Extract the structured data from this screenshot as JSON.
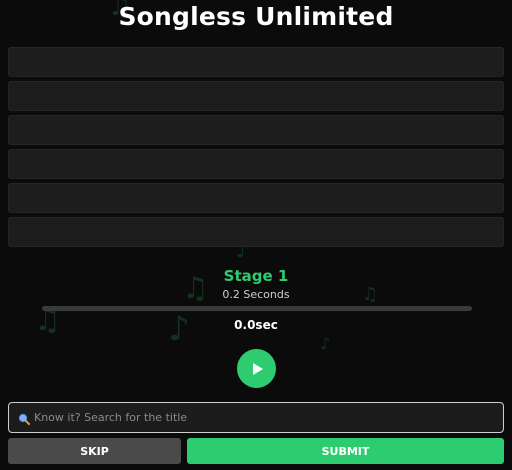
{
  "app": {
    "title": "Songless Unlimited"
  },
  "guess_slots": [
    "",
    "",
    "",
    "",
    "",
    ""
  ],
  "stage": {
    "title": "Stage 1",
    "subtitle": "0.2 Seconds",
    "progress_fraction": 0
  },
  "timer": {
    "text": "0.0sec"
  },
  "player": {
    "play_icon": "play-icon"
  },
  "search": {
    "placeholder": "Know it? Search for the title",
    "value": "",
    "icon": "search-icon"
  },
  "actions": {
    "skip_label": "SKIP",
    "submit_label": "SUBMIT"
  },
  "colors": {
    "accent": "#2ecc71",
    "background": "#0b0b0b",
    "slot": "#1d1d1d",
    "skip": "#4a4a4a"
  }
}
